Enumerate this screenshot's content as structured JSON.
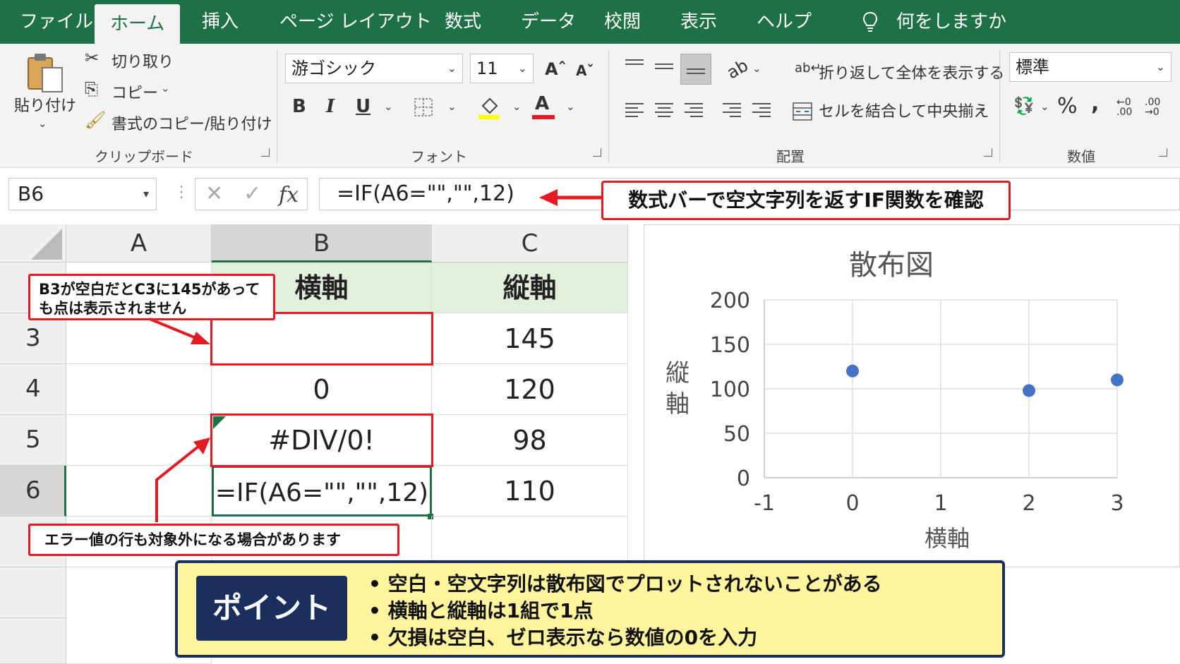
{
  "tabs": [
    "ファイル",
    "ホーム",
    "挿入",
    "ページ レイアウト",
    "数式",
    "データ",
    "校閲",
    "表示",
    "ヘルプ"
  ],
  "active_tab": "ホーム",
  "tell_me": "何をしますか",
  "ribbon": {
    "clipboard": {
      "paste": "貼り付け",
      "cut": "切り取り",
      "copy": "コピー",
      "format_painter": "書式のコピー/貼り付け",
      "group_label": "クリップボード"
    },
    "font": {
      "font_name": "游ゴシック",
      "font_size": "11",
      "bold": "B",
      "italic": "I",
      "underline": "U",
      "group_label": "フォント"
    },
    "alignment": {
      "wrap_text": "折り返して全体を表示する",
      "merge_center": "セルを結合して中央揃え",
      "group_label": "配置"
    },
    "number": {
      "format": "標準",
      "percent": "%",
      "comma": ",",
      "group_label": "数値"
    }
  },
  "formula_bar": {
    "name_box": "B6",
    "fx": "fx",
    "formula": "=IF(A6=\"\",\"\",12)"
  },
  "callout_top": "数式バーで空文字列を返すIF関数を確認",
  "sheet": {
    "columns": [
      "A",
      "B",
      "C"
    ],
    "rows": [
      "3",
      "4",
      "5",
      "6"
    ],
    "header_row": {
      "b": "横軸",
      "c": "縦軸"
    },
    "data": [
      {
        "row": "3",
        "b": "",
        "c": "145"
      },
      {
        "row": "4",
        "b": "0",
        "c": "120"
      },
      {
        "row": "5",
        "b": "#DIV/0!",
        "c": "98"
      },
      {
        "row": "6",
        "b": "=IF(A6=\"\",\"\",12)",
        "c": "110"
      }
    ]
  },
  "notes": {
    "b3_note": "B3が空白だとC3に145があっても点は表示されません",
    "error_note": "エラー値の行も対象外になる場合があります"
  },
  "point": {
    "label": "ポイント",
    "items": [
      "• 空白・空文字列は散布図でプロットされないことがある",
      "• 横軸と縦軸は1組で1点",
      "• 欠損は空白、ゼロ表示なら数値の0を入力"
    ]
  },
  "chart_data": {
    "type": "scatter",
    "title": "散布図",
    "xlabel": "横軸",
    "ylabel": "縦軸",
    "xlim": [
      -1,
      3
    ],
    "ylim": [
      0,
      200
    ],
    "x_ticks": [
      "-1",
      "0",
      "1",
      "2",
      "3"
    ],
    "y_ticks": [
      "0",
      "50",
      "100",
      "150",
      "200"
    ],
    "points": [
      {
        "x": 0,
        "y": 120
      },
      {
        "x": 2,
        "y": 98
      },
      {
        "x": 3,
        "y": 110
      }
    ],
    "marker_color": "#4472c4",
    "grid": true
  },
  "colors": {
    "excel_green": "#1e7145",
    "callout_red": "#e31b23",
    "point_navy": "#1a2f5e",
    "point_yellow": "#fff59c"
  }
}
